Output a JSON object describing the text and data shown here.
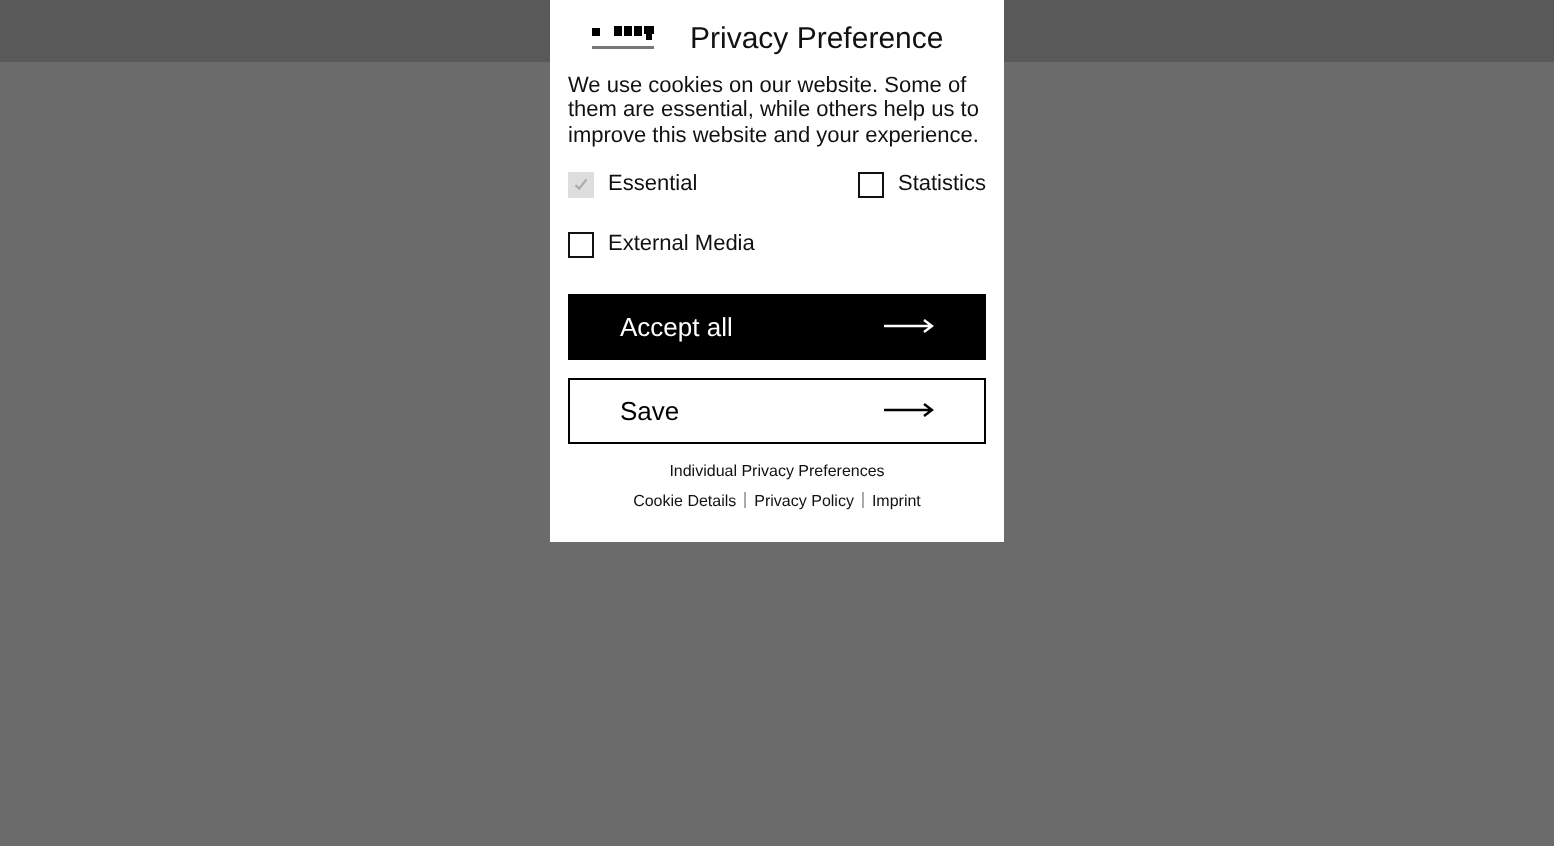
{
  "dialog": {
    "title": "Privacy Preference",
    "text": "We use cookies on our website. Some of them are essential, while others help us to improve this website and your experience.",
    "options": [
      {
        "label": "Essential",
        "checked": true,
        "disabled": true
      },
      {
        "label": "Statistics",
        "checked": false,
        "disabled": false
      },
      {
        "label": "External Media",
        "checked": false,
        "disabled": false
      }
    ],
    "buttons": [
      {
        "label": "Accept all",
        "kind": "primary"
      },
      {
        "label": "Save",
        "kind": "secondary"
      }
    ],
    "individual_link": "Individual Privacy Preferences",
    "links": [
      "Cookie Details",
      "Privacy Policy",
      "Imprint"
    ]
  }
}
